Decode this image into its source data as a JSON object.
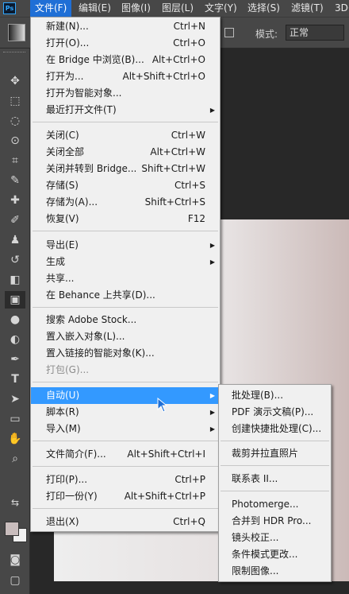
{
  "app_icon": "Ps",
  "menubar": [
    "文件(F)",
    "编辑(E)",
    "图像(I)",
    "图层(L)",
    "文字(Y)",
    "选择(S)",
    "滤镜(T)",
    "3D("
  ],
  "options_bar": {
    "mode_label": "模式:",
    "mode_value": "正常"
  },
  "toolbar_icons": [
    "move-icon",
    "marquee-icon",
    "lasso-icon",
    "quick-select-icon",
    "crop-icon",
    "eyedropper-icon",
    "healing-brush-icon",
    "brush-icon",
    "clone-stamp-icon",
    "history-brush-icon",
    "eraser-icon",
    "gradient-icon",
    "blur-icon",
    "dodge-icon",
    "pen-icon",
    "type-icon",
    "path-select-icon",
    "rectangle-icon",
    "hand-icon",
    "zoom-icon"
  ],
  "colors": {
    "accent": "#3399ff",
    "foreground_swatch": "#c9bdbd",
    "background_swatch": "#f0f0f0"
  },
  "file_menu": {
    "items": [
      {
        "label": "新建(N)...",
        "shortcut": "Ctrl+N"
      },
      {
        "label": "打开(O)...",
        "shortcut": "Ctrl+O"
      },
      {
        "label": "在 Bridge 中浏览(B)...",
        "shortcut": "Alt+Ctrl+O"
      },
      {
        "label": "打开为...",
        "shortcut": "Alt+Shift+Ctrl+O"
      },
      {
        "label": "打开为智能对象...",
        "shortcut": ""
      },
      {
        "label": "最近打开文件(T)",
        "shortcut": "",
        "submenu": true
      },
      {
        "label": "关闭(C)",
        "shortcut": "Ctrl+W"
      },
      {
        "label": "关闭全部",
        "shortcut": "Alt+Ctrl+W"
      },
      {
        "label": "关闭并转到 Bridge...",
        "shortcut": "Shift+Ctrl+W"
      },
      {
        "label": "存储(S)",
        "shortcut": "Ctrl+S"
      },
      {
        "label": "存储为(A)...",
        "shortcut": "Shift+Ctrl+S"
      },
      {
        "label": "恢复(V)",
        "shortcut": "F12"
      },
      {
        "label": "导出(E)",
        "shortcut": "",
        "submenu": true
      },
      {
        "label": "生成",
        "shortcut": "",
        "submenu": true
      },
      {
        "label": "共享...",
        "shortcut": ""
      },
      {
        "label": "在 Behance 上共享(D)...",
        "shortcut": ""
      },
      {
        "label": "搜索 Adobe Stock...",
        "shortcut": ""
      },
      {
        "label": "置入嵌入对象(L)...",
        "shortcut": ""
      },
      {
        "label": "置入链接的智能对象(K)...",
        "shortcut": ""
      },
      {
        "label": "打包(G)...",
        "shortcut": "",
        "disabled": true
      },
      {
        "label": "自动(U)",
        "shortcut": "",
        "submenu": true,
        "highlighted": true
      },
      {
        "label": "脚本(R)",
        "shortcut": "",
        "submenu": true
      },
      {
        "label": "导入(M)",
        "shortcut": "",
        "submenu": true
      },
      {
        "label": "文件简介(F)...",
        "shortcut": "Alt+Shift+Ctrl+I"
      },
      {
        "label": "打印(P)...",
        "shortcut": "Ctrl+P"
      },
      {
        "label": "打印一份(Y)",
        "shortcut": "Alt+Shift+Ctrl+P"
      },
      {
        "label": "退出(X)",
        "shortcut": "Ctrl+Q"
      }
    ]
  },
  "automate_submenu": {
    "items": [
      "批处理(B)...",
      "PDF 演示文稿(P)...",
      "创建快捷批处理(C)...",
      "裁剪并拉直照片",
      "联系表 II...",
      "Photomerge...",
      "合并到 HDR Pro...",
      "镜头校正...",
      "条件模式更改...",
      "限制图像..."
    ]
  }
}
